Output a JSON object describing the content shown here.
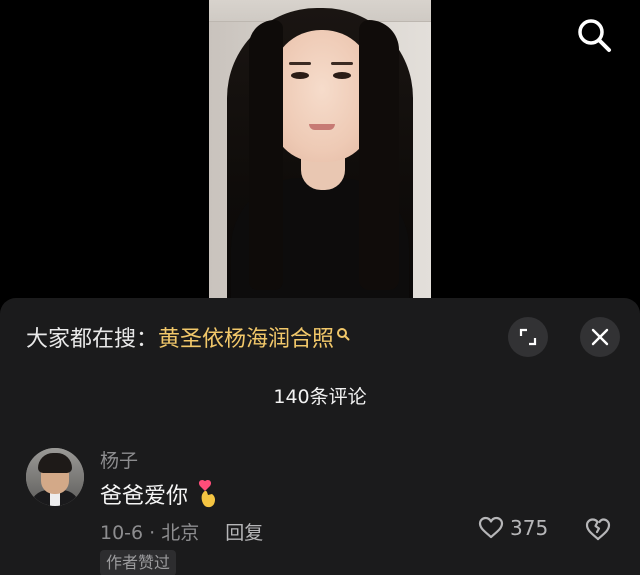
{
  "icons": {
    "search": "search-icon",
    "expand": "expand-icon",
    "close": "close-icon",
    "like": "heart-outline-icon",
    "dislike": "broken-heart-icon",
    "emoji": "heart-hands-emoji"
  },
  "colors": {
    "sheet_bg": "#1b1b1c",
    "highlight": "#f2c86a",
    "muted_text": "#8d8d8f"
  },
  "trending": {
    "prefix": "大家都在搜：",
    "query": "黄圣依杨海润合照"
  },
  "comments_header": {
    "count_label": "140条评论"
  },
  "comment": {
    "username": "杨子",
    "text": "爸爸爱你",
    "date_location": "10-6 · 北京",
    "reply_label": "回复",
    "like_count": "375",
    "badge": "作者赞过"
  }
}
